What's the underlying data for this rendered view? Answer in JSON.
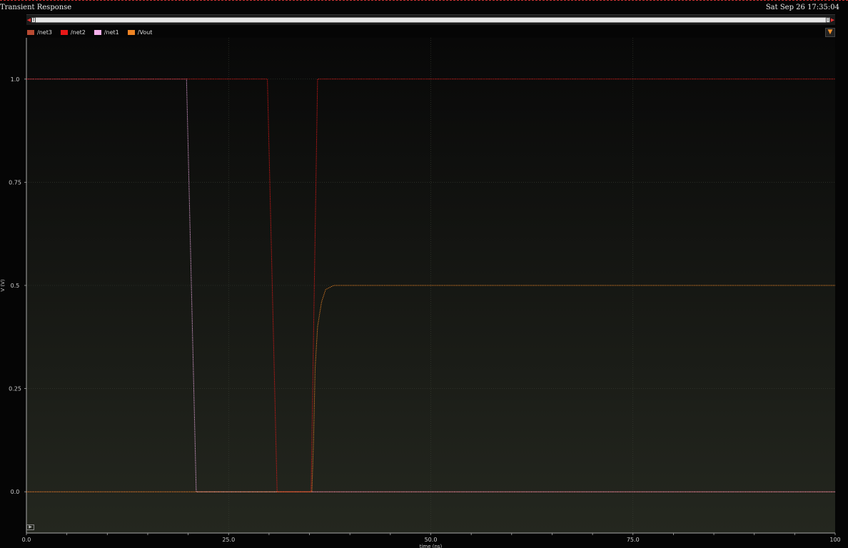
{
  "window": {
    "title": "Transient Response",
    "datetime": "Sat Sep 26 17:35:04"
  },
  "legend": [
    {
      "name": "/net3",
      "color": "#b84a32"
    },
    {
      "name": "/net2",
      "color": "#e81818"
    },
    {
      "name": "/net1",
      "color": "#f6b2ec"
    },
    {
      "name": "/Vout",
      "color": "#ee8424"
    }
  ],
  "icons": {
    "filter": "filter-icon",
    "expand": "play-icon",
    "scroll_left": "scroll-left-icon",
    "scroll_right": "scroll-right-icon"
  },
  "chart_data": {
    "type": "line",
    "title": "Transient Response",
    "xlabel": "time (ns)",
    "ylabel": "V (V)",
    "xlim": [
      0,
      100
    ],
    "ylim": [
      -0.1,
      1.1
    ],
    "xticks": [
      0,
      25,
      50,
      75,
      100
    ],
    "xtick_labels": [
      "0.0",
      "25.0",
      "50.0",
      "75.0",
      "100"
    ],
    "yticks": [
      0,
      0.25,
      0.5,
      0.75,
      1.0
    ],
    "ytick_labels": [
      "0.0",
      "0.25",
      "0.5",
      "0.75",
      "1.0"
    ],
    "grid": true,
    "legend_position": "top-left",
    "series": [
      {
        "name": "/net1",
        "color": "#f6b2ec",
        "x": [
          0,
          19.8,
          21.0,
          100
        ],
        "y": [
          1.0,
          1.0,
          0.0,
          0.0
        ]
      },
      {
        "name": "/net3",
        "color": "#b84a32",
        "x": [
          0,
          29.8,
          31.0,
          100
        ],
        "y": [
          0.0,
          0.0,
          0.0,
          0.0
        ]
      },
      {
        "name": "/net2",
        "color": "#e81818",
        "x": [
          0,
          29.8,
          31.0,
          35.2,
          36.0,
          100
        ],
        "y": [
          1.0,
          1.0,
          0.0,
          0.0,
          1.0,
          1.0
        ]
      },
      {
        "name": "/Vout",
        "color": "#ee8424",
        "x": [
          0,
          35.3,
          35.5,
          35.7,
          36.0,
          36.5,
          37.0,
          38.0,
          40.0,
          100
        ],
        "y": [
          0.0,
          0.0,
          0.12,
          0.3,
          0.4,
          0.46,
          0.49,
          0.5,
          0.5,
          0.5
        ]
      }
    ]
  }
}
